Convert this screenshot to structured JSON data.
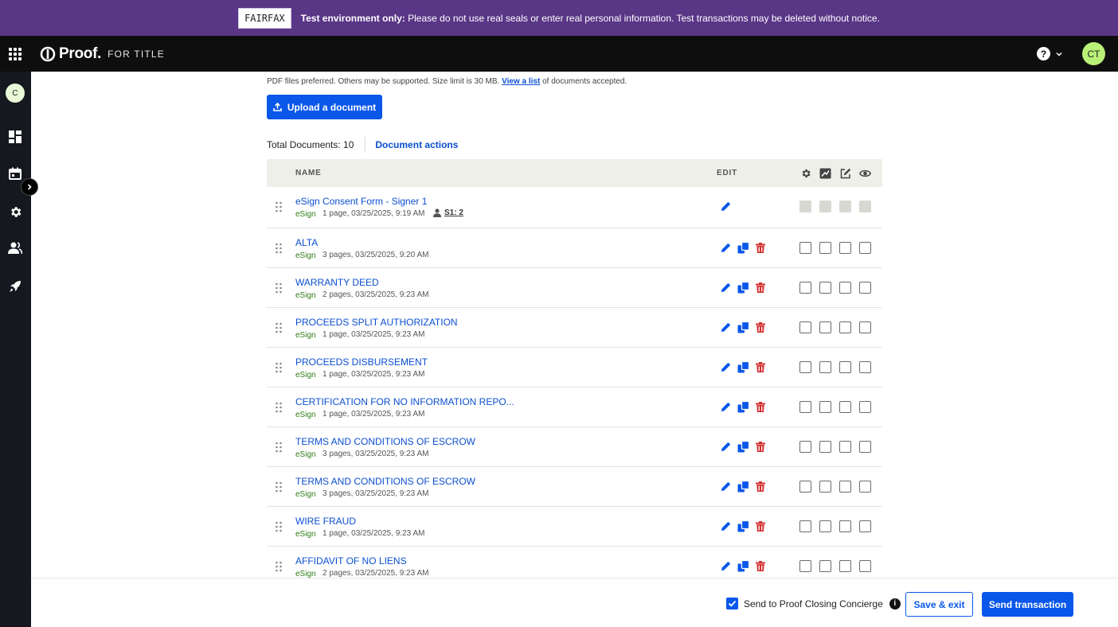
{
  "banner": {
    "badge": "FAIRFAX",
    "bold_text": "Test environment only:",
    "text": " Please do not use real seals or enter real personal information. Test transactions may be deleted without notice."
  },
  "topnav": {
    "logo_word": "Proof.",
    "logo_sub": "FOR TITLE",
    "help_icon": "question-circle-icon",
    "user_initials": "CT"
  },
  "sidebar": {
    "org_initial": "C",
    "items": [
      "dashboard-icon",
      "calendar-icon",
      "gear-icon",
      "users-icon",
      "rocket-icon"
    ]
  },
  "upload": {
    "hint_prefix": "PDF files preferred. Others may be supported. Size limit is 30 MB. ",
    "hint_link": "View a list",
    "hint_suffix": " of documents accepted.",
    "button_label": "Upload a document"
  },
  "summary": {
    "total_label": "Total Documents: 10",
    "actions_label": "Document actions"
  },
  "table": {
    "col_name": "NAME",
    "col_edit": "EDIT",
    "header_icons": [
      "gear-icon",
      "stamp-icon",
      "sign-icon",
      "eye-icon"
    ],
    "rows": [
      {
        "name": "eSign Consent Form - Signer 1",
        "type": "eSign",
        "meta": "1 page, 03/25/2025, 9:19 AM",
        "signer": "S1: 2",
        "locked": true
      },
      {
        "name": "ALTA",
        "type": "eSign",
        "meta": "3 pages, 03/25/2025, 9:20 AM",
        "locked": false
      },
      {
        "name": "WARRANTY DEED",
        "type": "eSign",
        "meta": "2 pages, 03/25/2025, 9:23 AM",
        "locked": false
      },
      {
        "name": "PROCEEDS SPLIT AUTHORIZATION",
        "type": "eSign",
        "meta": "1 page, 03/25/2025, 9:23 AM",
        "locked": false
      },
      {
        "name": "PROCEEDS DISBURSEMENT",
        "type": "eSign",
        "meta": "1 page, 03/25/2025, 9:23 AM",
        "locked": false
      },
      {
        "name": "CERTIFICATION FOR NO INFORMATION REPO...",
        "type": "eSign",
        "meta": "1 page, 03/25/2025, 9:23 AM",
        "locked": false
      },
      {
        "name": "TERMS AND CONDITIONS OF ESCROW",
        "type": "eSign",
        "meta": "3 pages, 03/25/2025, 9:23 AM",
        "locked": false
      },
      {
        "name": "TERMS AND CONDITIONS OF ESCROW",
        "type": "eSign",
        "meta": "3 pages, 03/25/2025, 9:23 AM",
        "locked": false
      },
      {
        "name": "WIRE FRAUD",
        "type": "eSign",
        "meta": "1 page, 03/25/2025, 9:23 AM",
        "locked": false
      },
      {
        "name": "AFFIDAVIT OF NO LIENS",
        "type": "eSign",
        "meta": "2 pages, 03/25/2025, 9:23 AM",
        "locked": false
      }
    ]
  },
  "footer": {
    "concierge_label": "Send to Proof Closing Concierge",
    "concierge_checked": true,
    "save_exit_label": "Save & exit",
    "send_label": "Send transaction"
  },
  "colors": {
    "banner": "#5a3687",
    "primary": "#0a57ea",
    "delete": "#d32f2f",
    "esign": "#2e7d16"
  }
}
